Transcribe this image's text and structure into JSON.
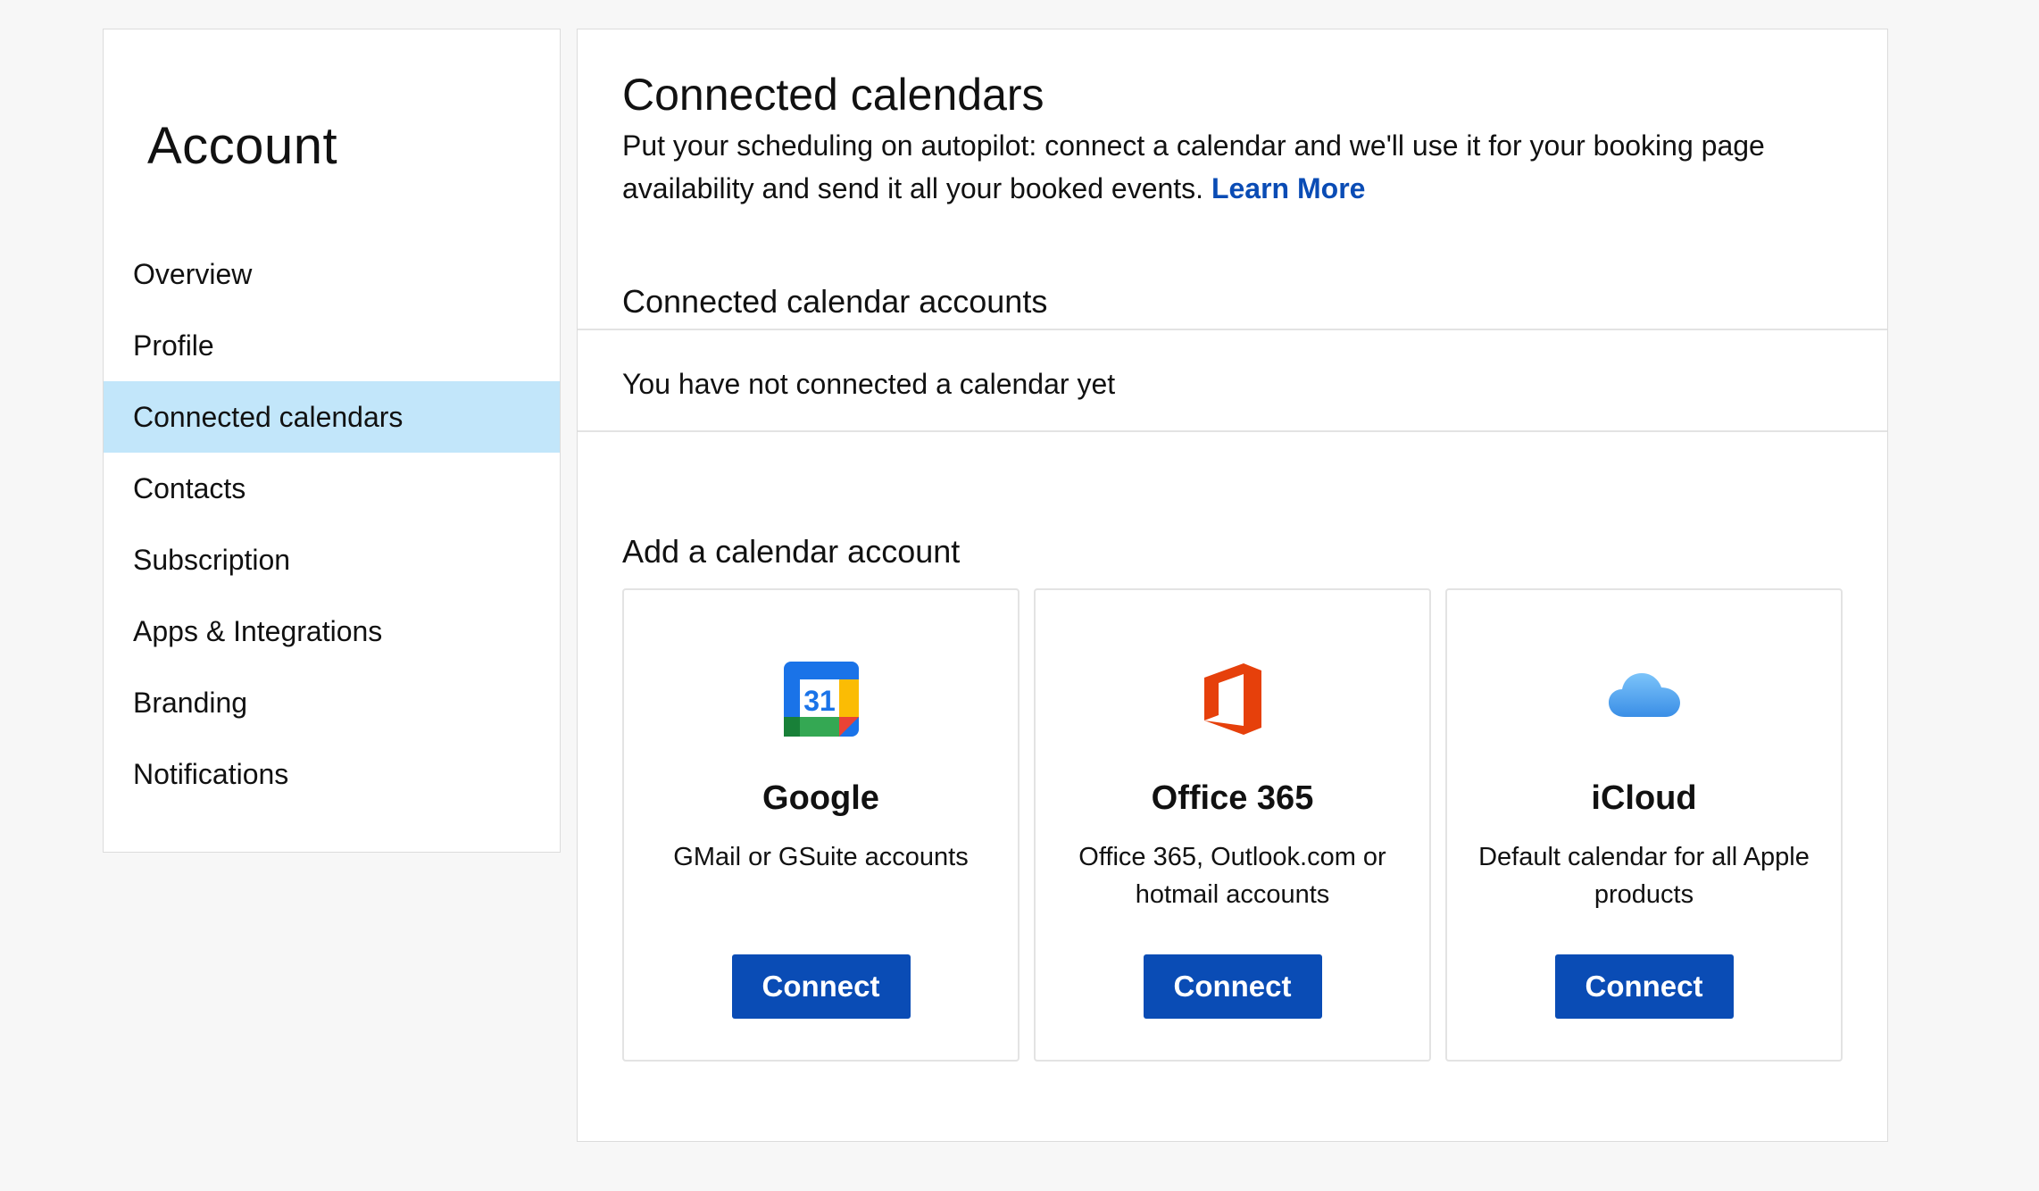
{
  "sidebar": {
    "title": "Account",
    "items": [
      {
        "label": "Overview"
      },
      {
        "label": "Profile"
      },
      {
        "label": "Connected calendars"
      },
      {
        "label": "Contacts"
      },
      {
        "label": "Subscription"
      },
      {
        "label": "Apps & Integrations"
      },
      {
        "label": "Branding"
      },
      {
        "label": "Notifications"
      }
    ],
    "active_item": "Connected calendars"
  },
  "main": {
    "title": "Connected calendars",
    "intro_text": "Put your scheduling on autopilot: connect a calendar and we'll use it for your booking page availability and send it all your booked events.",
    "learn_more_label": "Learn More",
    "connected_heading": "Connected calendar accounts",
    "empty_message": "You have not connected a calendar yet",
    "add_heading": "Add a calendar account",
    "providers": [
      {
        "name": "Google",
        "description": "GMail or GSuite accounts",
        "button_label": "Connect",
        "icon": "google-calendar-icon",
        "icon_text": "31"
      },
      {
        "name": "Office 365",
        "description": "Office 365, Outlook.com or hotmail accounts",
        "button_label": "Connect",
        "icon": "office-365-icon"
      },
      {
        "name": "iCloud",
        "description": "Default calendar for all Apple products",
        "button_label": "Connect",
        "icon": "icloud-icon"
      }
    ]
  },
  "colors": {
    "accent": "#0a4cb5",
    "active_nav_background": "#c2e6fa",
    "page_background": "#f7f7f7"
  }
}
